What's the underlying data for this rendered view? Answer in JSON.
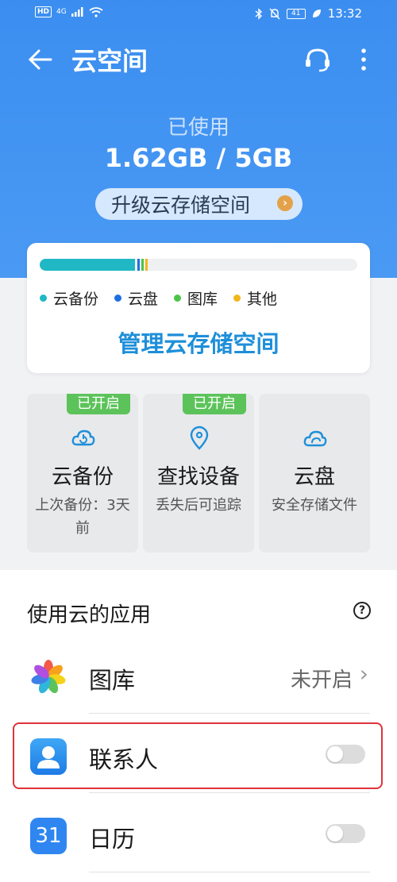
{
  "status_bar": {
    "hd": "HD",
    "net": "4G",
    "time": "13:32",
    "battery": "41"
  },
  "header": {
    "title": "云空间"
  },
  "usage": {
    "label": "已使用",
    "value": "1.62GB / 5GB",
    "upgrade_label": "升级云存储空间"
  },
  "storage": {
    "bar_fractions": [
      {
        "name": "云备份",
        "color": "#1fb8c4",
        "fraction": 0.3
      },
      {
        "name": "云盘",
        "color": "#1e6fe0",
        "fraction": 0.012
      },
      {
        "name": "图库",
        "color": "#4cc44a",
        "fraction": 0.012
      },
      {
        "name": "其他",
        "color": "#f1b61b",
        "fraction": 0.008
      }
    ],
    "legend": [
      {
        "label": "云备份",
        "color": "#1fb8c4"
      },
      {
        "label": "云盘",
        "color": "#1e6fe0"
      },
      {
        "label": "图库",
        "color": "#4cc44a"
      },
      {
        "label": "其他",
        "color": "#f1b61b"
      }
    ],
    "manage_label": "管理云存储空间"
  },
  "tiles": [
    {
      "badge": "已开启",
      "name": "云备份",
      "desc": "上次备份：3天前",
      "icon": "cloud-backup-icon"
    },
    {
      "badge": "已开启",
      "name": "查找设备",
      "desc": "丢失后可追踪",
      "icon": "location-pin-icon"
    },
    {
      "badge": "",
      "name": "云盘",
      "desc": "安全存储文件",
      "icon": "cloud-drive-icon"
    }
  ],
  "apps_section": {
    "title": "使用云的应用",
    "help": "?",
    "rows": [
      {
        "label": "图库",
        "status": "未开启",
        "icon": "gallery-icon",
        "enabled": false
      },
      {
        "label": "联系人",
        "icon": "contacts-icon",
        "enabled": false
      },
      {
        "label": "日历",
        "icon": "calendar-icon",
        "icon_text": "31",
        "enabled": false
      }
    ]
  }
}
